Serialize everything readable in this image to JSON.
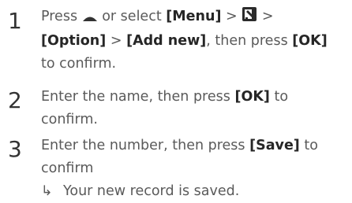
{
  "steps": [
    {
      "number": "1",
      "line1_pre": "Press",
      "line1_mid": "or select",
      "menu": "[Menu]",
      "sep": ">",
      "line2_option": "[Option]",
      "add_new": "[Add new]",
      "line2_post": ", then press",
      "ok": "[OK]",
      "line3": "to confirm.",
      "up_icon": "up-triangle-icon",
      "contacts_icon": "contacts-icon"
    },
    {
      "number": "2",
      "line1_pre": "Enter the name, then press",
      "ok": "[OK]",
      "line1_post": "to",
      "line2": "confirm."
    },
    {
      "number": "3",
      "line1_pre": "Enter the number, then press",
      "save": "[Save]",
      "line1_post": "to",
      "line2": "confirm",
      "result_arrow": "↳",
      "result_text": "Your new record is saved."
    }
  ]
}
